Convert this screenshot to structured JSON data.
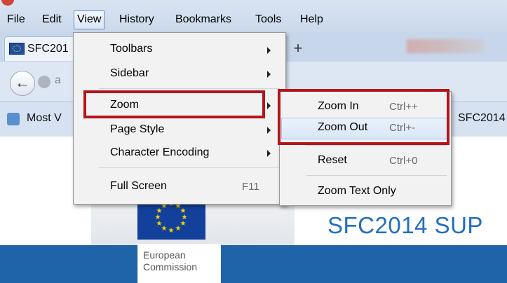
{
  "menubar": {
    "items": [
      "File",
      "Edit",
      "View",
      "History",
      "Bookmarks",
      "Tools",
      "Help"
    ],
    "active": "View"
  },
  "tabs": {
    "active_title": "SFC201",
    "new_tab_symbol": "+"
  },
  "navigation": {
    "back_symbol": "←",
    "url_fragment": "a"
  },
  "bookmarks": {
    "most_visited": "Most V",
    "sfc": "SFC2014"
  },
  "view_menu": {
    "items": [
      {
        "label": "Toolbars",
        "submenu": true
      },
      {
        "label": "Sidebar",
        "submenu": true
      },
      {
        "label": "Zoom",
        "submenu": true,
        "highlighted": true
      },
      {
        "label": "Page Style",
        "submenu": true
      },
      {
        "label": "Character Encoding",
        "submenu": true
      },
      {
        "label": "Full Screen",
        "shortcut": "F11"
      }
    ]
  },
  "zoom_menu": {
    "items": [
      {
        "label": "Zoom In",
        "shortcut": "Ctrl++",
        "highlighted": true
      },
      {
        "label": "Zoom Out",
        "shortcut": "Ctrl+-",
        "highlighted": true,
        "hovered": true
      },
      {
        "label": "Reset",
        "shortcut": "Ctrl+0"
      },
      {
        "label": "Zoom Text Only"
      }
    ]
  },
  "page": {
    "logo_line1": "European",
    "logo_line2": "Commission",
    "site_title": "SFC2014 SUP"
  },
  "colors": {
    "highlight_frame": "#b3151b",
    "site_title": "#1f6fc1",
    "band": "#1f63a8",
    "eu_flag": "#12409a"
  }
}
